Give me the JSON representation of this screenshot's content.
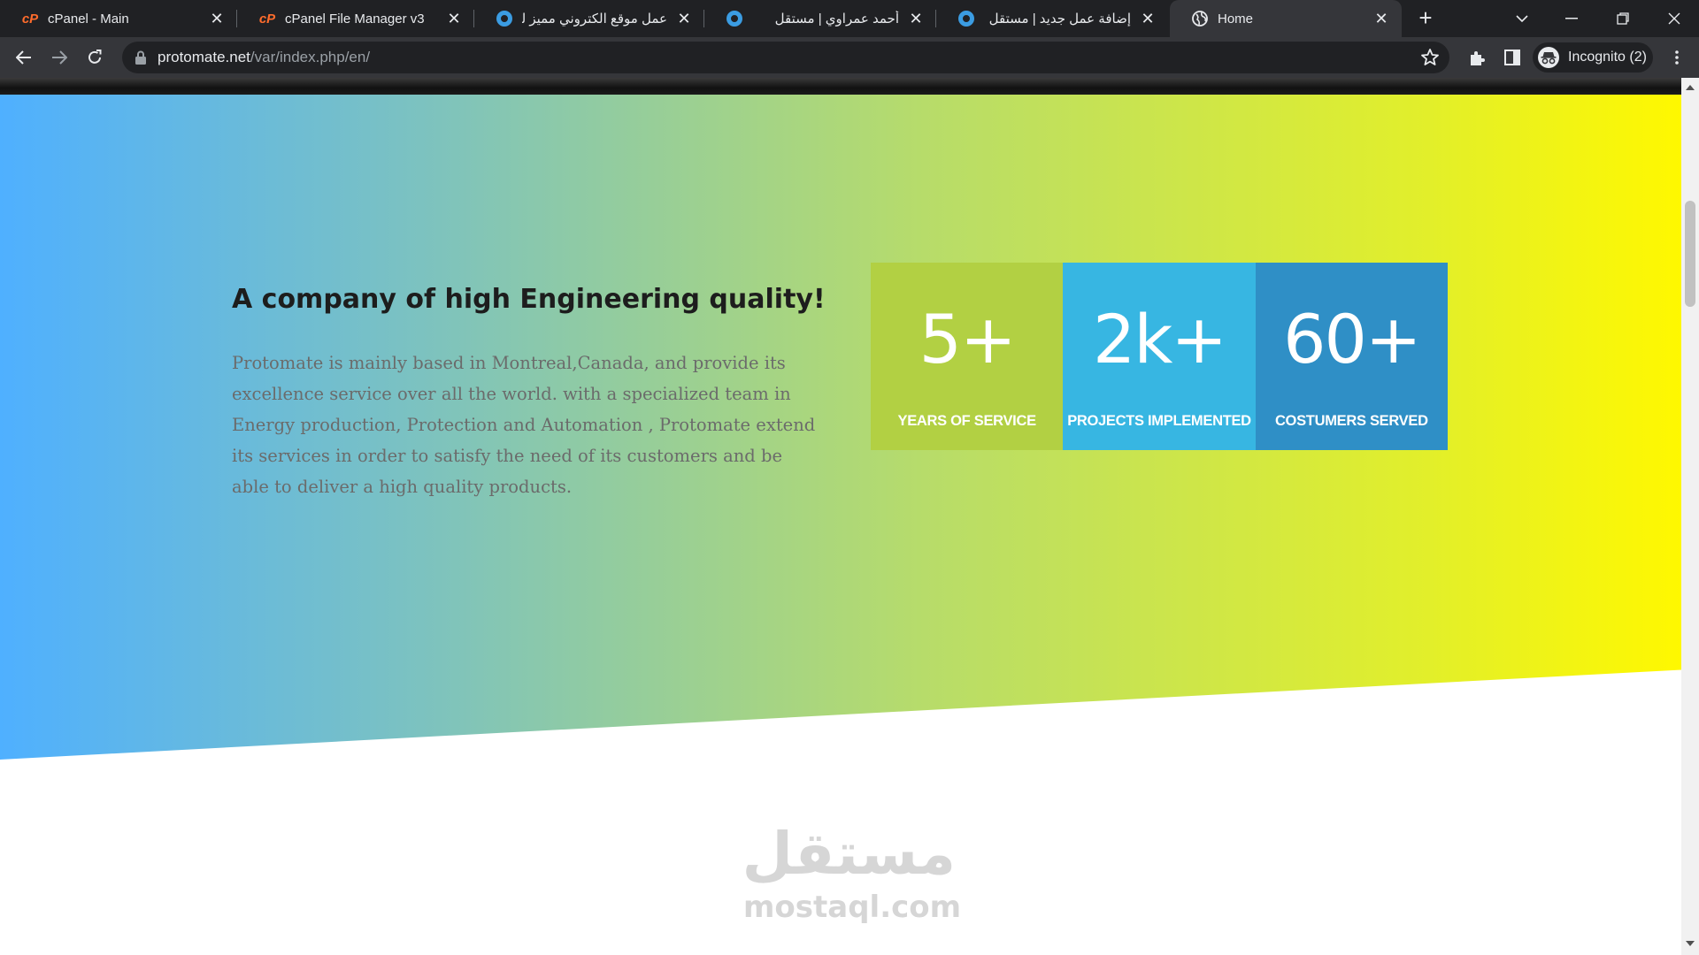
{
  "browser": {
    "tabs": [
      {
        "title": "cPanel - Main",
        "favicon": "cpanel-icon",
        "active": false
      },
      {
        "title": "cPanel File Manager v3",
        "favicon": "cpanel-icon",
        "active": false
      },
      {
        "title": "عمل موقع الكتروني مميز لشر",
        "favicon": "mostaql-icon",
        "active": false
      },
      {
        "title": "أحمد عمراوي | مستقل",
        "favicon": "mostaql-icon",
        "active": false
      },
      {
        "title": "إضافة عمل جديد | مستقل",
        "favicon": "mostaql-icon",
        "active": false
      },
      {
        "title": "Home",
        "favicon": "globe-icon",
        "active": true
      }
    ],
    "url_host": "protomate.net",
    "url_path": "/var/index.php/en/",
    "profile_label": "Incognito (2)",
    "cpanel_mark": "cP",
    "close_glyph": "✕",
    "new_tab_glyph": "+"
  },
  "page": {
    "heading": "A company of high Engineering quality!",
    "paragraph": "Protomate is mainly based in Montreal,Canada, and provide its excellence service over all the world. with a specialized team in Energy production, Protection and Automation , Protomate extend its services in order to satisfy the need of its customers and be able to deliver a high quality products.",
    "stats": [
      {
        "value": "5+",
        "label": "YEARS OF SERVICE",
        "color": "#b2d043"
      },
      {
        "value": "2k+",
        "label": "PROJECTS IMPLEMENTED",
        "color": "#37b6e2"
      },
      {
        "value": "60+",
        "label": "COSTUMERS SERVED",
        "color": "#2f8fc6"
      }
    ],
    "gradient_colors": [
      "#4fb0ff",
      "#fff800"
    ]
  },
  "watermark": {
    "arabic": "مستقل",
    "latin": "mostaql.com"
  }
}
